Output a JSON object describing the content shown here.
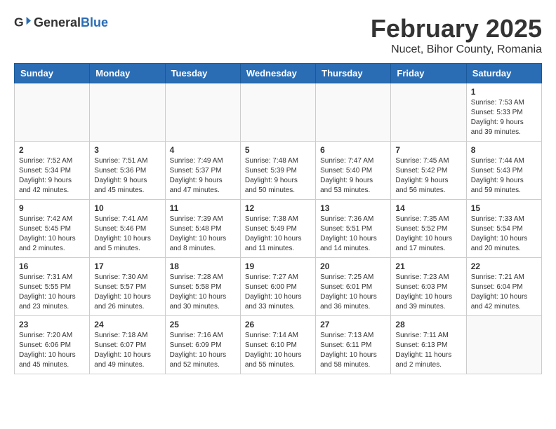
{
  "logo": {
    "general": "General",
    "blue": "Blue"
  },
  "title": "February 2025",
  "subtitle": "Nucet, Bihor County, Romania",
  "days_of_week": [
    "Sunday",
    "Monday",
    "Tuesday",
    "Wednesday",
    "Thursday",
    "Friday",
    "Saturday"
  ],
  "weeks": [
    [
      {
        "day": "",
        "info": ""
      },
      {
        "day": "",
        "info": ""
      },
      {
        "day": "",
        "info": ""
      },
      {
        "day": "",
        "info": ""
      },
      {
        "day": "",
        "info": ""
      },
      {
        "day": "",
        "info": ""
      },
      {
        "day": "1",
        "info": "Sunrise: 7:53 AM\nSunset: 5:33 PM\nDaylight: 9 hours and 39 minutes."
      }
    ],
    [
      {
        "day": "2",
        "info": "Sunrise: 7:52 AM\nSunset: 5:34 PM\nDaylight: 9 hours and 42 minutes."
      },
      {
        "day": "3",
        "info": "Sunrise: 7:51 AM\nSunset: 5:36 PM\nDaylight: 9 hours and 45 minutes."
      },
      {
        "day": "4",
        "info": "Sunrise: 7:49 AM\nSunset: 5:37 PM\nDaylight: 9 hours and 47 minutes."
      },
      {
        "day": "5",
        "info": "Sunrise: 7:48 AM\nSunset: 5:39 PM\nDaylight: 9 hours and 50 minutes."
      },
      {
        "day": "6",
        "info": "Sunrise: 7:47 AM\nSunset: 5:40 PM\nDaylight: 9 hours and 53 minutes."
      },
      {
        "day": "7",
        "info": "Sunrise: 7:45 AM\nSunset: 5:42 PM\nDaylight: 9 hours and 56 minutes."
      },
      {
        "day": "8",
        "info": "Sunrise: 7:44 AM\nSunset: 5:43 PM\nDaylight: 9 hours and 59 minutes."
      }
    ],
    [
      {
        "day": "9",
        "info": "Sunrise: 7:42 AM\nSunset: 5:45 PM\nDaylight: 10 hours and 2 minutes."
      },
      {
        "day": "10",
        "info": "Sunrise: 7:41 AM\nSunset: 5:46 PM\nDaylight: 10 hours and 5 minutes."
      },
      {
        "day": "11",
        "info": "Sunrise: 7:39 AM\nSunset: 5:48 PM\nDaylight: 10 hours and 8 minutes."
      },
      {
        "day": "12",
        "info": "Sunrise: 7:38 AM\nSunset: 5:49 PM\nDaylight: 10 hours and 11 minutes."
      },
      {
        "day": "13",
        "info": "Sunrise: 7:36 AM\nSunset: 5:51 PM\nDaylight: 10 hours and 14 minutes."
      },
      {
        "day": "14",
        "info": "Sunrise: 7:35 AM\nSunset: 5:52 PM\nDaylight: 10 hours and 17 minutes."
      },
      {
        "day": "15",
        "info": "Sunrise: 7:33 AM\nSunset: 5:54 PM\nDaylight: 10 hours and 20 minutes."
      }
    ],
    [
      {
        "day": "16",
        "info": "Sunrise: 7:31 AM\nSunset: 5:55 PM\nDaylight: 10 hours and 23 minutes."
      },
      {
        "day": "17",
        "info": "Sunrise: 7:30 AM\nSunset: 5:57 PM\nDaylight: 10 hours and 26 minutes."
      },
      {
        "day": "18",
        "info": "Sunrise: 7:28 AM\nSunset: 5:58 PM\nDaylight: 10 hours and 30 minutes."
      },
      {
        "day": "19",
        "info": "Sunrise: 7:27 AM\nSunset: 6:00 PM\nDaylight: 10 hours and 33 minutes."
      },
      {
        "day": "20",
        "info": "Sunrise: 7:25 AM\nSunset: 6:01 PM\nDaylight: 10 hours and 36 minutes."
      },
      {
        "day": "21",
        "info": "Sunrise: 7:23 AM\nSunset: 6:03 PM\nDaylight: 10 hours and 39 minutes."
      },
      {
        "day": "22",
        "info": "Sunrise: 7:21 AM\nSunset: 6:04 PM\nDaylight: 10 hours and 42 minutes."
      }
    ],
    [
      {
        "day": "23",
        "info": "Sunrise: 7:20 AM\nSunset: 6:06 PM\nDaylight: 10 hours and 45 minutes."
      },
      {
        "day": "24",
        "info": "Sunrise: 7:18 AM\nSunset: 6:07 PM\nDaylight: 10 hours and 49 minutes."
      },
      {
        "day": "25",
        "info": "Sunrise: 7:16 AM\nSunset: 6:09 PM\nDaylight: 10 hours and 52 minutes."
      },
      {
        "day": "26",
        "info": "Sunrise: 7:14 AM\nSunset: 6:10 PM\nDaylight: 10 hours and 55 minutes."
      },
      {
        "day": "27",
        "info": "Sunrise: 7:13 AM\nSunset: 6:11 PM\nDaylight: 10 hours and 58 minutes."
      },
      {
        "day": "28",
        "info": "Sunrise: 7:11 AM\nSunset: 6:13 PM\nDaylight: 11 hours and 2 minutes."
      },
      {
        "day": "",
        "info": ""
      }
    ]
  ]
}
